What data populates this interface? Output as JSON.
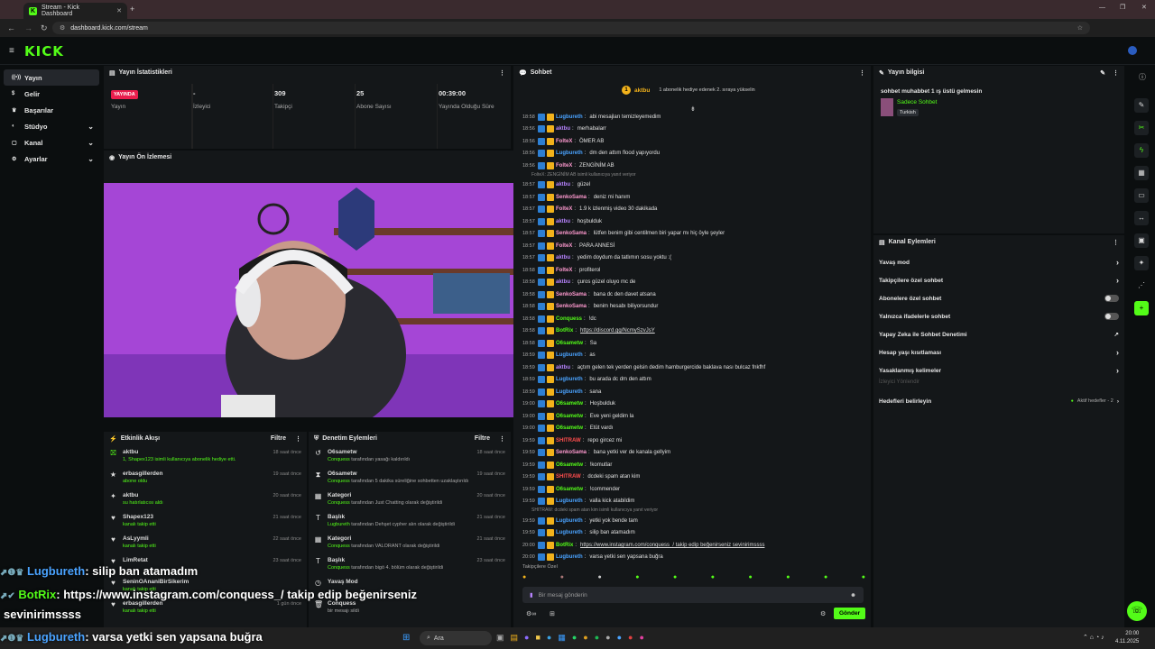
{
  "browser": {
    "tab_title": "Stream - Kick Dashboard",
    "url": "dashboard.kick.com/stream"
  },
  "nav": {
    "logo": "KICK",
    "items": [
      {
        "label": "Yayın",
        "icon": "broadcast-icon",
        "active": true
      },
      {
        "label": "Gelir",
        "icon": "dollar-icon"
      },
      {
        "label": "Başarılar",
        "icon": "trophy-icon"
      },
      {
        "label": "Stüdyo",
        "icon": "palette-icon",
        "chevron": true
      },
      {
        "label": "Kanal",
        "icon": "channel-icon",
        "chevron": true
      },
      {
        "label": "Ayarlar",
        "icon": "gear-icon",
        "chevron": true
      }
    ]
  },
  "stats": {
    "title": "Yayın İstatistikleri",
    "items": [
      {
        "value": "YAYINDA",
        "label": "Yayın"
      },
      {
        "value": "-",
        "label": "İzleyici"
      },
      {
        "value": "309",
        "label": "Takipçi"
      },
      {
        "value": "25",
        "label": "Abone Sayısı"
      },
      {
        "value": "00:39:00",
        "label": "Yayında Olduğu Süre"
      }
    ]
  },
  "preview": {
    "title": "Yayın Ön İzlemesi"
  },
  "activity": {
    "title": "Etkinlik Akışı",
    "filter": "Filtre",
    "items": [
      {
        "name": "aktbu",
        "sub": "1, Shapex123 isimli kullanıcıya abonelik hediye etti.",
        "time": "18 saat önce",
        "icon": "gift-icon"
      },
      {
        "name": "erbasgillerden",
        "sub": "abone oldu",
        "time": "19 saat önce",
        "icon": "star-icon"
      },
      {
        "name": "aktbu",
        "sub": "su hatırlatıcısı aldı",
        "time": "20 saat önce",
        "icon": "reward-icon"
      },
      {
        "name": "Shapex123",
        "sub": "kanalı takip etti",
        "time": "21 saat önce",
        "icon": "heart-icon"
      },
      {
        "name": "AsLyymli",
        "sub": "kanalı takip etti",
        "time": "22 saat önce",
        "icon": "heart-icon"
      },
      {
        "name": "LimRetat",
        "sub": "",
        "time": "23 saat önce",
        "icon": "heart-icon"
      },
      {
        "name": "SeninOAnaniBirSikerim",
        "sub": "kanalı takip etti",
        "time": "",
        "icon": "heart-icon"
      },
      {
        "name": "erbasgillerden",
        "sub": "kanalı takip etti",
        "time": "1 gün önce",
        "icon": "heart-icon"
      }
    ]
  },
  "moderation": {
    "title": "Denetim Eylemleri",
    "filter": "Filtre",
    "items": [
      {
        "name": "O6sametw",
        "sub_user": "Conquess",
        "sub": " tarafından yasağı kaldırıldı",
        "time": "18 saat önce",
        "icon": "unban-icon"
      },
      {
        "name": "O6sametw",
        "sub_user": "Conquess",
        "sub": " tarafından 5 dakika süreliğine sohbetten uzaklaştırıldı",
        "time": "19 saat önce",
        "icon": "hourglass-icon"
      },
      {
        "name": "Kategori",
        "sub_user": "Conquess",
        "sub": " tarafından Just Chatting olarak değiştirildi",
        "time": "20 saat önce",
        "icon": "category-icon"
      },
      {
        "name": "Başlık",
        "sub_user": "Lugbureth",
        "sub": " tarafından Dehşet cypher alın olarak değiştirildi",
        "time": "21 saat önce",
        "icon": "title-icon"
      },
      {
        "name": "Kategori",
        "sub_user": "Conquess",
        "sub": " tarafından VALORANT olarak değiştirildi",
        "time": "21 saat önce",
        "icon": "category-icon"
      },
      {
        "name": "Başlık",
        "sub_user": "Conquess",
        "sub": " tarafından bigö 4. bölüm olarak değiştirildi",
        "time": "23 saat önce",
        "icon": "title-icon"
      },
      {
        "name": "Yavaş Mod",
        "sub_user": "",
        "sub": "",
        "time": "",
        "icon": "slow-icon"
      },
      {
        "name": "Conquess",
        "sub_user": "",
        "sub": "bir mesajı sildi",
        "time": "",
        "icon": "trash-icon"
      }
    ]
  },
  "chat": {
    "title": "Sohbet",
    "pinned_user": "aktbu",
    "pinned_count": "1",
    "pinned_text": "1 abonelik hediye edenek 2. sıraya yükselin",
    "followers_only": "Takipçilere Özel",
    "input_placeholder": "Bir mesaj gönderin",
    "send_label": "Gönder",
    "messages": [
      {
        "t": "18:58",
        "u": "Lugbureth",
        "c": "#4aa3ff",
        "m": "abi mesajları temizleyemedim"
      },
      {
        "t": "18:56",
        "u": "aktbu",
        "c": "#b884ff",
        "m": "merhabalarr"
      },
      {
        "t": "18:56",
        "u": "FolteX",
        "c": "#ff9ad0",
        "m": "ÖMER AB"
      },
      {
        "t": "18:56",
        "u": "Lugbureth",
        "c": "#4aa3ff",
        "m": "dm den attım flood yapıyordu"
      },
      {
        "t": "18:56",
        "u": "FolteX",
        "c": "#ff9ad0",
        "m": "ZENGİNİM AB"
      },
      {
        "reply": "FolteX: ZENGİNİM AB isimli kullanıcıya yanıt veriyor"
      },
      {
        "t": "18:57",
        "u": "aktbu",
        "c": "#b884ff",
        "m": "güzel"
      },
      {
        "t": "18:57",
        "u": "SenkoSama",
        "c": "#ff9ad0",
        "m": "deniz mi hanım"
      },
      {
        "t": "18:57",
        "u": "FolteX",
        "c": "#ff9ad0",
        "m": "1.9 k izlenmiş video 30 dakikada"
      },
      {
        "t": "18:57",
        "u": "aktbu",
        "c": "#b884ff",
        "m": "hoşbulduk"
      },
      {
        "t": "18:57",
        "u": "SenkoSama",
        "c": "#ff9ad0",
        "m": "lütfen benim gibi centilmen biri yapar mı hiç öyle şeyler"
      },
      {
        "t": "18:57",
        "u": "FolteX",
        "c": "#ff9ad0",
        "m": "PARA ANNESİ"
      },
      {
        "t": "18:57",
        "u": "aktbu",
        "c": "#b884ff",
        "m": "yedim doydum da tatlımın sosu yoktu :("
      },
      {
        "t": "18:58",
        "u": "FolteX",
        "c": "#ff9ad0",
        "m": "profiterol"
      },
      {
        "t": "18:58",
        "u": "aktbu",
        "c": "#b884ff",
        "m": "çuros güzel oluyo mc de"
      },
      {
        "t": "18:58",
        "u": "SenkoSama",
        "c": "#ff9ad0",
        "m": "bana dc den davet atsana"
      },
      {
        "t": "18:58",
        "u": "SenkoSama",
        "c": "#ff9ad0",
        "m": "benim hesabı biliyorsundur"
      },
      {
        "t": "18:58",
        "u": "Conquess",
        "c": "#53fc18",
        "m": "!dc"
      },
      {
        "t": "18:58",
        "u": "BotRix",
        "c": "#53fc18",
        "m": "https://discord.gg/NcmySzvJsY",
        "link": true
      },
      {
        "t": "18:58",
        "u": "O6sametw",
        "c": "#53fc18",
        "m": "Sa"
      },
      {
        "t": "18:59",
        "u": "Lugbureth",
        "c": "#4aa3ff",
        "m": "as"
      },
      {
        "t": "18:59",
        "u": "aktbu",
        "c": "#b884ff",
        "m": "açtım gelen tek yerden gelsin dedim hamburgercide baklava nası bulcaz fnkfhf"
      },
      {
        "t": "18:59",
        "u": "Lugbureth",
        "c": "#4aa3ff",
        "m": "bu arada dc dm den attım"
      },
      {
        "t": "18:59",
        "u": "Lugbureth",
        "c": "#4aa3ff",
        "m": "sana"
      },
      {
        "t": "19:00",
        "u": "O6sametw",
        "c": "#53fc18",
        "m": "Hoşbulduk"
      },
      {
        "t": "19:00",
        "u": "O6sametw",
        "c": "#53fc18",
        "m": "Eve yeni geldim la"
      },
      {
        "t": "19:00",
        "u": "O6sametw",
        "c": "#53fc18",
        "m": "Etüt vardı"
      },
      {
        "t": "19:59",
        "u": "SHITRAW",
        "c": "#ff4d4d",
        "m": "repo gircez mi"
      },
      {
        "t": "19:59",
        "u": "SenkoSama",
        "c": "#ff9ad0",
        "m": "bana yetki ver de kanala gellyim"
      },
      {
        "t": "19:59",
        "u": "O6sametw",
        "c": "#53fc18",
        "m": "!komutlar"
      },
      {
        "t": "19:59",
        "u": "SHITRAW",
        "c": "#ff4d4d",
        "m": "dcdeki spam atan kim"
      },
      {
        "t": "19:59",
        "u": "O6sametw",
        "c": "#53fc18",
        "m": "!commender"
      },
      {
        "t": "19:59",
        "u": "Lugbureth",
        "c": "#4aa3ff",
        "m": "valla kick atabildim"
      },
      {
        "reply": "SHITRAW: dcdeki spam atan kim isimli kullanıcıya yanıt veriyor"
      },
      {
        "t": "19:59",
        "u": "Lugbureth",
        "c": "#4aa3ff",
        "m": "yetki yok bende tam"
      },
      {
        "t": "19:59",
        "u": "Lugbureth",
        "c": "#4aa3ff",
        "m": "silip ban atamadım"
      },
      {
        "t": "20:00",
        "u": "BotRix",
        "c": "#53fc18",
        "m": "https://www.instagram.com/conquess_/ takip edip beğenirseniz sevinirimssss",
        "link": true
      },
      {
        "t": "20:00",
        "u": "Lugbureth",
        "c": "#4aa3ff",
        "m": "varsa yetki sen yapsana buğra"
      }
    ]
  },
  "stream_info": {
    "title": "Yayın bilgisi",
    "stream_title": "sohbet muhabbet 1 ış üstü gelmesin",
    "category": "Sadece Sohbet",
    "language": "Turkish"
  },
  "channel_actions": {
    "title": "Kanal Eylemleri",
    "items": [
      {
        "label": "Yavaş mod",
        "type": "chevron"
      },
      {
        "label": "Takipçilere özel sohbet",
        "type": "chevron"
      },
      {
        "label": "Abonelere özel sohbet",
        "type": "toggle"
      },
      {
        "label": "Yalnızca ifadelerle sohbet",
        "type": "toggle"
      },
      {
        "label": "Yapay Zeka ile Sohbet Denetimi",
        "type": "external"
      },
      {
        "label": "Hesap yaşı kısıtlaması",
        "type": "chevron"
      },
      {
        "label": "Yasaklanmış kelimeler",
        "type": "chevron"
      }
    ],
    "viewer_label": "İzleyici Yönlendir",
    "goals_label": "Hedefleri belirleyin",
    "goals_status": "Aktif hedefler - 2"
  },
  "overlay": {
    "line1_user": "Lugbureth",
    "line1_msg": ": silip ban atamadım",
    "line2_user": "BotRix",
    "line2_msg": ": https://www.instagram.com/conquess_/ takip edip beğenirseniz",
    "line3": "sevinirimssss",
    "line4_user": "Lugbureth",
    "line4_msg": ": varsa yetki sen yapsana buğra"
  },
  "taskbar": {
    "search": "Ara",
    "time": "20:00",
    "date": "4.11.2025"
  },
  "colors": {
    "accent": "#53fc18",
    "live": "#e91e4d"
  }
}
